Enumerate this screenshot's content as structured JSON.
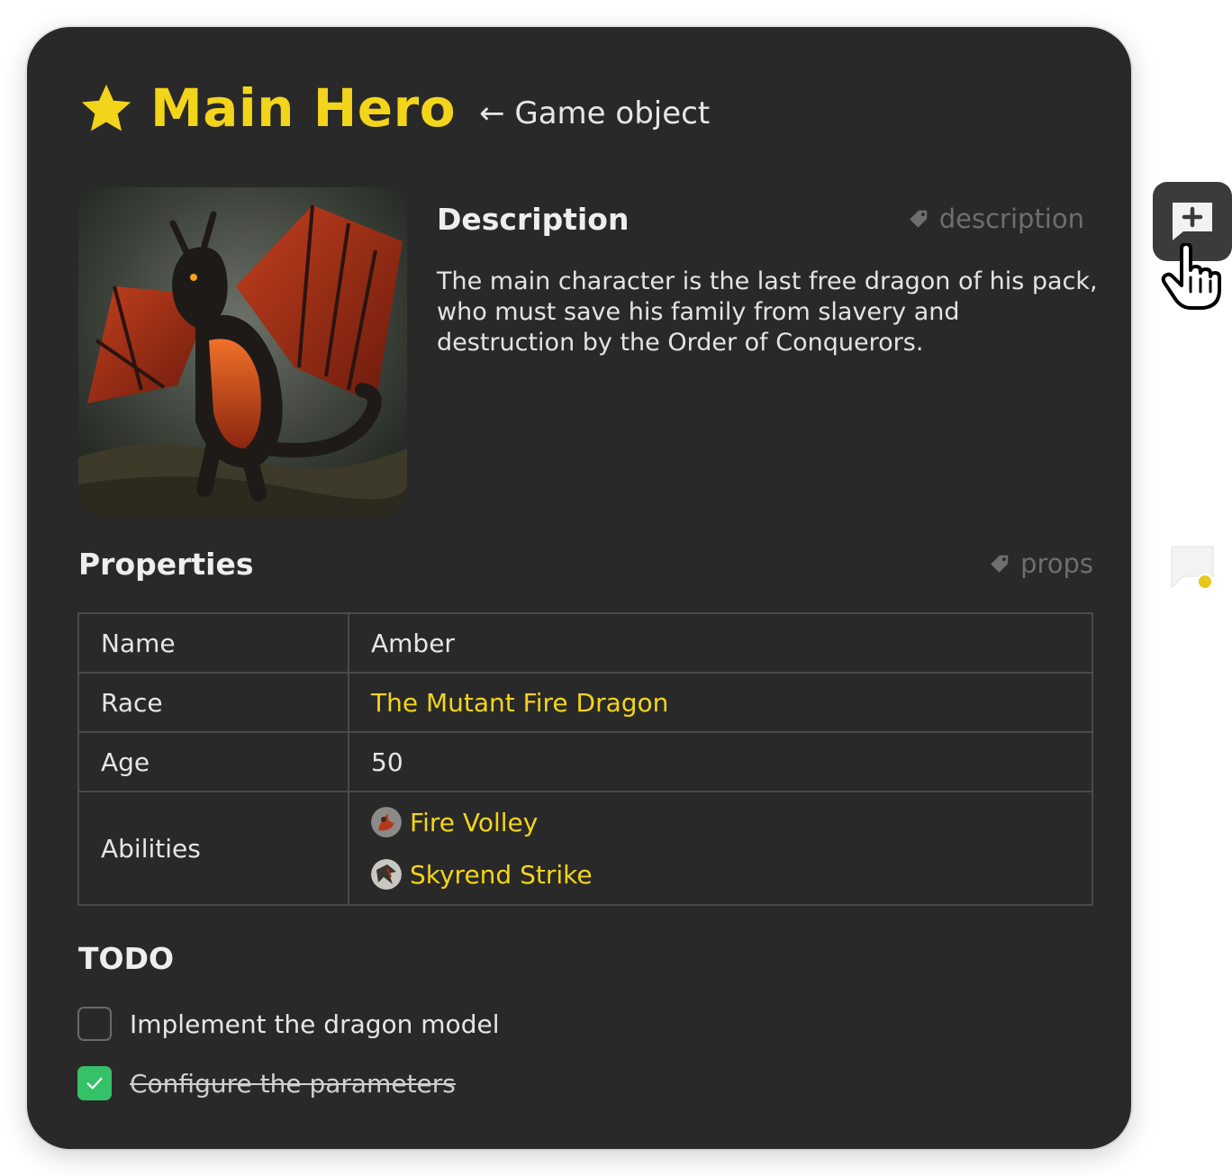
{
  "header": {
    "title": "Main Hero",
    "subtitle": "← Game object",
    "title_color": "#f2d51a"
  },
  "description": {
    "heading": "Description",
    "tag": "description",
    "text": "The main character is the last free dragon of his pack, who must save his family from slavery and destruction by the Order of Conquerors."
  },
  "properties": {
    "heading": "Properties",
    "tag": "props",
    "rows": [
      {
        "key": "Name",
        "value": "Amber"
      },
      {
        "key": "Race",
        "value": "The Mutant Fire Dragon"
      },
      {
        "key": "Age",
        "value": "50"
      },
      {
        "key": "Abilities",
        "values": [
          "Fire Volley",
          "Skyrend Strike"
        ]
      }
    ]
  },
  "todo": {
    "heading": "TODO",
    "items": [
      {
        "label": "Implement the dragon model",
        "checked": false
      },
      {
        "label": "Configure the parameters",
        "checked": true
      }
    ]
  },
  "side": {
    "comment_button_icon": "comment-add-icon",
    "cursor_icon": "hand-pointer-icon",
    "marker_color": "#e8c81a"
  },
  "colors": {
    "card_bg": "#2a2929",
    "accent": "#f2d51a",
    "checked": "#35c168"
  }
}
